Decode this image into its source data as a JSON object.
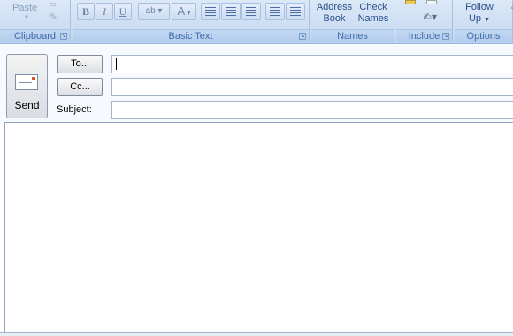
{
  "ribbon": {
    "clipboard": {
      "paste_label": "Paste",
      "group_label": "Clipboard"
    },
    "basic_text": {
      "group_label": "Basic Text",
      "bold": "B",
      "italic": "I",
      "underline": "U",
      "highlight": "ab",
      "font_color": "A"
    },
    "names": {
      "group_label": "Names",
      "address_book_line1": "Address",
      "address_book_line2": "Book",
      "check_names_line1": "Check",
      "check_names_line2": "Names"
    },
    "include": {
      "group_label": "Include"
    },
    "options": {
      "group_label": "Options",
      "follow_line1": "Follow",
      "follow_line2": "Up"
    }
  },
  "header": {
    "send_label": "Send",
    "to_label": "To...",
    "cc_label": "Cc...",
    "subject_label": "Subject:",
    "to_value": "",
    "cc_value": "",
    "subject_value": ""
  },
  "body": {
    "text": ""
  }
}
